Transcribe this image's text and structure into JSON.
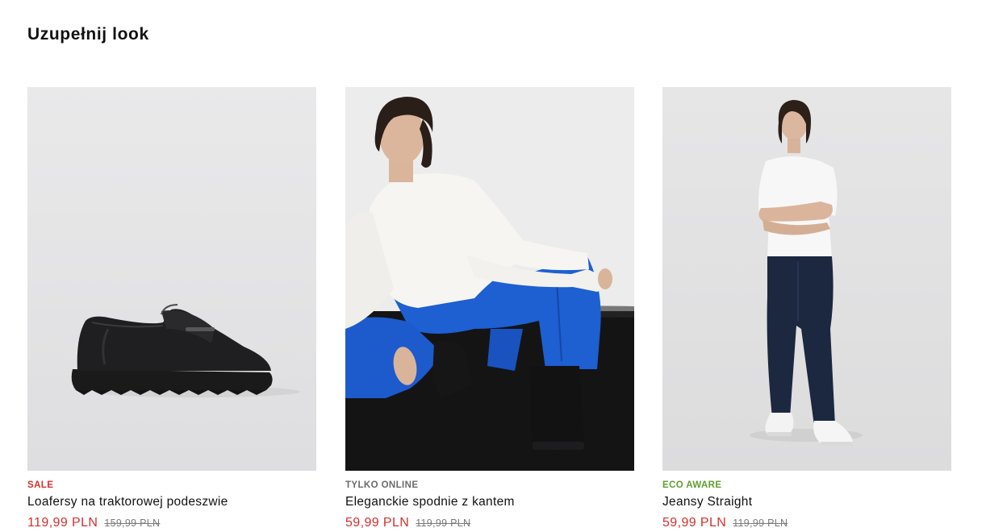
{
  "section": {
    "title": "Uzupełnij look"
  },
  "colors": {
    "sale": "#d4302f",
    "online": "#6b6b6b",
    "eco": "#5f9f2f",
    "price_now": "#d4302f"
  },
  "products": [
    {
      "badge": "SALE",
      "badge_color": "#d4302f",
      "name": "Loafersy na traktorowej podeszwie",
      "price_now": "119,99 PLN",
      "price_old": "159,99 PLN",
      "image": "black-loafer-shoe-photo"
    },
    {
      "badge": "TYLKO ONLINE",
      "badge_color": "#6b6b6b",
      "name": "Eleganckie spodnie z kantem",
      "price_now": "59,99 PLN",
      "price_old": "119,99 PLN",
      "image": "model-blue-trousers-photo"
    },
    {
      "badge": "ECO AWARE",
      "badge_color": "#5f9f2f",
      "name": "Jeansy Straight",
      "price_now": "59,99 PLN",
      "price_old": "119,99 PLN",
      "image": "model-straight-jeans-photo"
    }
  ]
}
